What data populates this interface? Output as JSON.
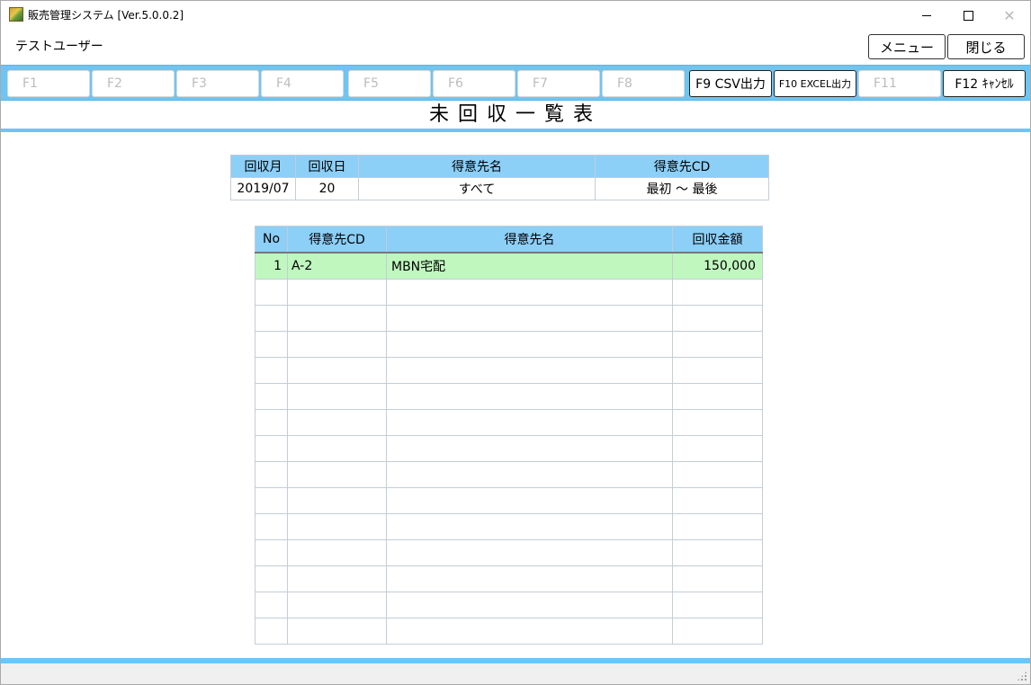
{
  "window": {
    "title": "販売管理システム [Ver.5.0.0.2]",
    "controls": {
      "minimize": "—",
      "maximize": "□",
      "close": "✕"
    }
  },
  "header": {
    "user": "テストユーザー",
    "menu_label": "メニュー",
    "close_label": "閉じる"
  },
  "function_keys": [
    {
      "key": "F1",
      "label": "F1",
      "enabled": false
    },
    {
      "key": "F2",
      "label": "F2",
      "enabled": false
    },
    {
      "key": "F3",
      "label": "F3",
      "enabled": false
    },
    {
      "key": "F4",
      "label": "F4",
      "enabled": false
    },
    {
      "key": "F5",
      "label": "F5",
      "enabled": false
    },
    {
      "key": "F6",
      "label": "F6",
      "enabled": false
    },
    {
      "key": "F7",
      "label": "F7",
      "enabled": false
    },
    {
      "key": "F8",
      "label": "F8",
      "enabled": false
    },
    {
      "key": "F9",
      "label": "F9 CSV出力",
      "enabled": true
    },
    {
      "key": "F10",
      "label": "F10 EXCEL出力",
      "enabled": true
    },
    {
      "key": "F11",
      "label": "F11",
      "enabled": false
    },
    {
      "key": "F12",
      "label": "F12 ｷｬﾝｾﾙ",
      "enabled": true
    }
  ],
  "page": {
    "title": "未回収一覧表"
  },
  "filter": {
    "headers": [
      "回収月",
      "回収日",
      "得意先名",
      "得意先CD"
    ],
    "values": [
      "2019/07",
      "20",
      "すべて",
      "最初 ～ 最後"
    ]
  },
  "results": {
    "headers": [
      "No",
      "得意先CD",
      "得意先名",
      "回収金額"
    ],
    "rows": [
      {
        "no": "1",
        "cd": "A-2",
        "name": "MBN宅配",
        "amount": "150,000"
      }
    ],
    "empty_rows": 14
  },
  "colors": {
    "accent": "#6cc6f5",
    "header_cell": "#8ccff7",
    "selected_row": "#c0f7bf"
  }
}
